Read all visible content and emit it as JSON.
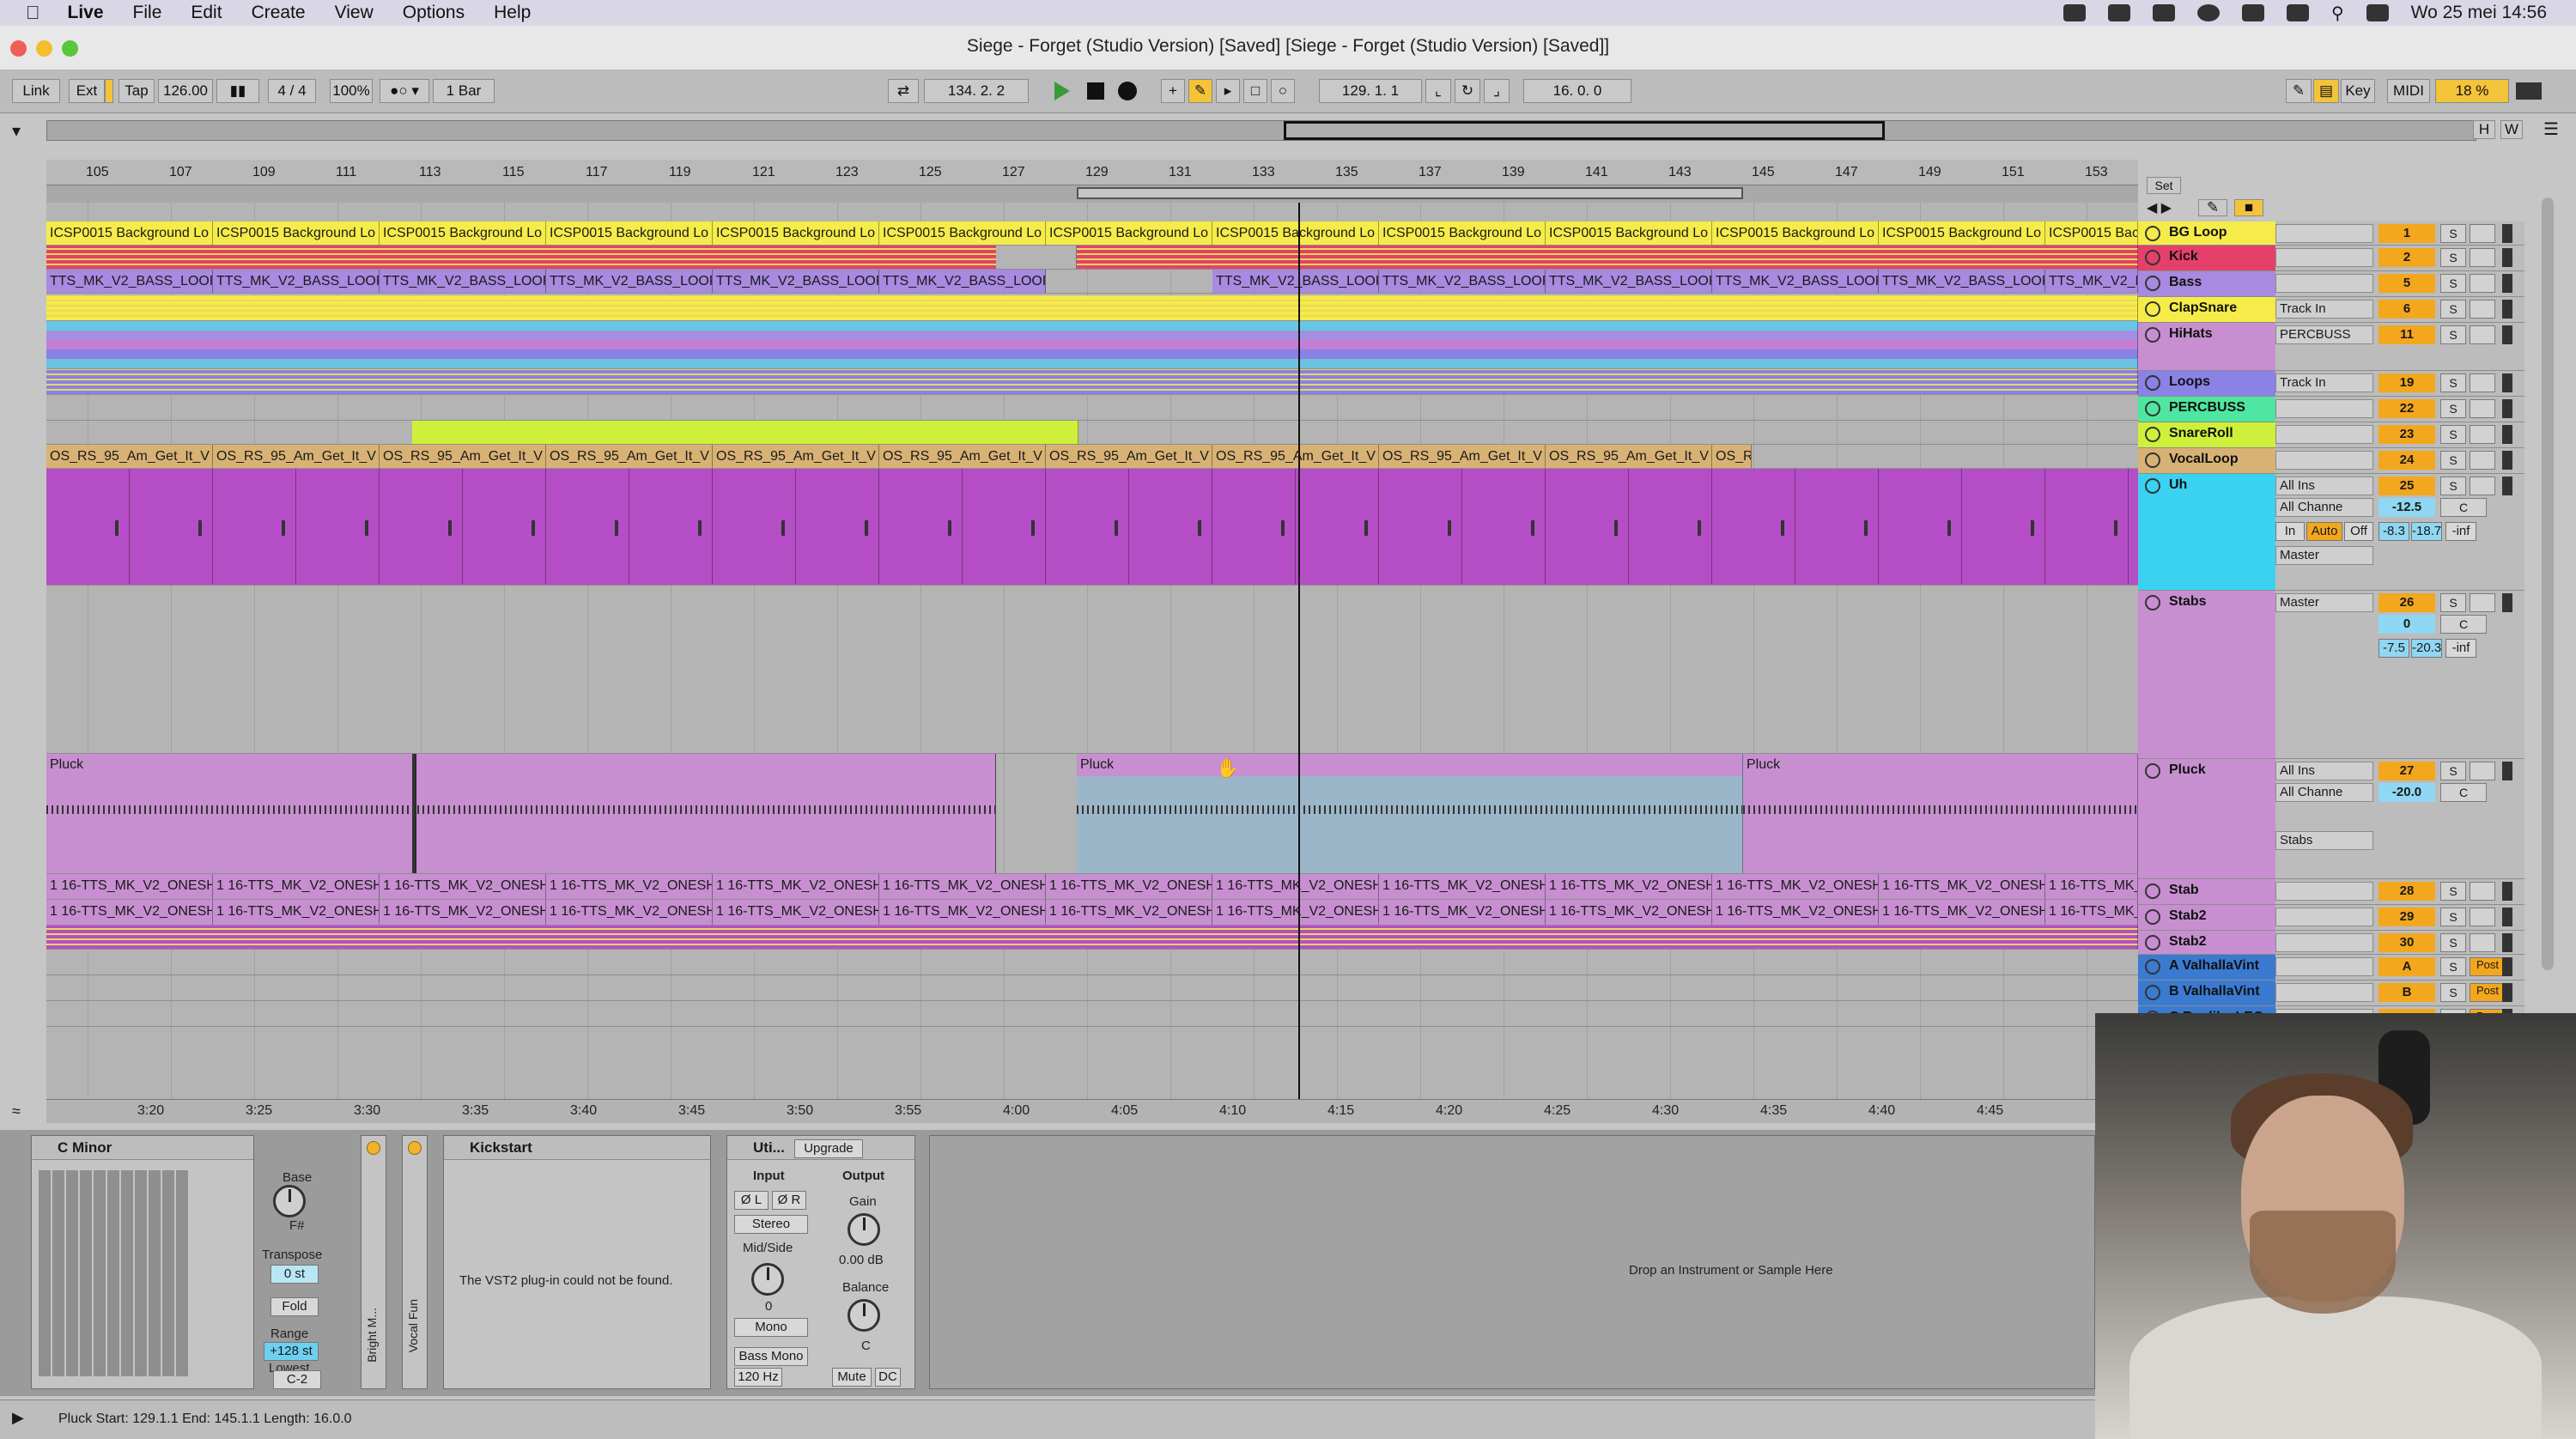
{
  "menubar": {
    "app": "Live",
    "items": [
      "File",
      "Edit",
      "Create",
      "View",
      "Options",
      "Help"
    ],
    "clock": "Wo 25 mei  14:56"
  },
  "window": {
    "title": "Siege - Forget (Studio Version) [Saved]  [Siege - Forget (Studio Version) [Saved]]"
  },
  "control": {
    "link": "Link",
    "ext": "Ext",
    "tap": "Tap",
    "tempo": "126.00",
    "sig": "4 / 4",
    "zoom": "100%",
    "quant": "1 Bar",
    "pos": "134.   2.   2",
    "loop_start": "129.   1.   1",
    "loop_len": "16.   0.   0",
    "key": "Key",
    "midi": "MIDI",
    "cpu": "18 %",
    "h": "H",
    "w": "W"
  },
  "ruler": {
    "bars": [
      "105",
      "107",
      "109",
      "111",
      "113",
      "115",
      "117",
      "119",
      "121",
      "123",
      "125",
      "127",
      "129",
      "131",
      "133",
      "135",
      "137",
      "139",
      "141",
      "143",
      "145",
      "147",
      "149",
      "151",
      "153"
    ],
    "set": "Set"
  },
  "timeruler": {
    "labels": [
      "3:20",
      "3:25",
      "3:30",
      "3:35",
      "3:40",
      "3:45",
      "3:50",
      "3:55",
      "4:00",
      "4:05",
      "4:10",
      "4:15",
      "4:20",
      "4:25",
      "4:30",
      "4:35",
      "4:40",
      "4:45"
    ]
  },
  "clipnames": {
    "bg": "ICSP0015 Background Lo",
    "bass": "TTS_MK_V2_BASS_LOOP",
    "vocal": "OS_RS_95_Am_Get_It_V",
    "pluck": "Pluck",
    "onesh": "1 16-TTS_MK_V2_ONESH"
  },
  "tracks": [
    {
      "name": "BG Loop",
      "io": "",
      "num": "1",
      "color": "#f5ec4a"
    },
    {
      "name": "Kick",
      "io": "",
      "num": "2",
      "color": "#e5406a"
    },
    {
      "name": "Bass",
      "io": "",
      "num": "5",
      "color": "#a88ae0"
    },
    {
      "name": "ClapSnare",
      "io": "Track In",
      "num": "6",
      "color": "#f5ec4a"
    },
    {
      "name": "HiHats",
      "io": "PERCBUSS",
      "num": "11",
      "color": "#c78fd0"
    },
    {
      "name": "Loops",
      "io": "Track In",
      "num": "19",
      "color": "#8a82e6"
    },
    {
      "name": "PERCBUSS",
      "io": "",
      "num": "22",
      "color": "#4ee6a0"
    },
    {
      "name": "SnareRoll",
      "io": "",
      "num": "23",
      "color": "#cff03a"
    },
    {
      "name": "VocalLoop",
      "io": "",
      "num": "24",
      "color": "#d8b274"
    },
    {
      "name": "Uh",
      "io": "All Ins",
      "num": "25",
      "color": "#3ad2f0"
    },
    {
      "name": "Stabs",
      "io": "Master",
      "num": "26",
      "color": "#c78fd0"
    },
    {
      "name": "Pluck",
      "io": "All Ins",
      "num": "27",
      "color": "#c78fd0"
    },
    {
      "name": "Stab",
      "io": "",
      "num": "28",
      "color": "#c78fd0"
    },
    {
      "name": "Stab2",
      "io": "",
      "num": "29",
      "color": "#c78fd0"
    },
    {
      "name": "Stab2",
      "io": "",
      "num": "30",
      "color": "#c78fd0"
    },
    {
      "name": "A ValhallaVint",
      "io": "",
      "num": "A",
      "color": "#3a7ad0"
    },
    {
      "name": "B ValhallaVint",
      "io": "",
      "num": "B",
      "color": "#3a7ad0"
    },
    {
      "name": "C Replika LEO",
      "io": "",
      "num": "C",
      "color": "#3a7ad0"
    }
  ],
  "mixer": {
    "uh": {
      "channel": "All Channe",
      "vol": "-12.5",
      "pan": "C",
      "in": "In",
      "auto": "Auto",
      "off": "Off",
      "m1": "-8.3",
      "m2": "-18.7",
      "m3": "-inf",
      "out": "Master"
    },
    "stabs": {
      "vol": "0",
      "pan": "C",
      "m1": "-7.5",
      "m2": "-20.3",
      "m3": "-inf"
    },
    "pluck": {
      "channel": "All Channe",
      "vol": "-20.0",
      "pan": "C",
      "out": "Stabs"
    },
    "post": "Post",
    "inf": "-inf",
    "s": "S"
  },
  "devices": {
    "scale": {
      "name": "C Minor",
      "base": "Base",
      "base_val": "F#",
      "transpose": "Transpose",
      "transpose_val": "0 st",
      "fold": "Fold",
      "range": "Range",
      "range_val": "+128 st",
      "lowest": "Lowest",
      "lowest_val": "C-2"
    },
    "rack1": "Bright M...",
    "rack2": "Vocal Fun",
    "kick": {
      "name": "Kickstart",
      "msg": "The VST2 plug-in could not be found."
    },
    "util": {
      "name": "Uti...",
      "upgrade": "Upgrade",
      "input": "Input",
      "output": "Output",
      "phl": "Ø L",
      "phr": "Ø R",
      "stereo": "Stereo",
      "gain": "Gain",
      "gain_val": "0.00 dB",
      "midside": "Mid/Side",
      "ms_val": "0",
      "balance": "Balance",
      "bal_val": "C",
      "mono": "Mono",
      "bassmono": "Bass Mono",
      "freq": "120 Hz",
      "mute": "Mute",
      "dc": "DC"
    },
    "drop": "Drop an Instrument or Sample Here"
  },
  "status": "Pluck  Start: 129.1.1  End: 145.1.1  Length: 16.0.0"
}
